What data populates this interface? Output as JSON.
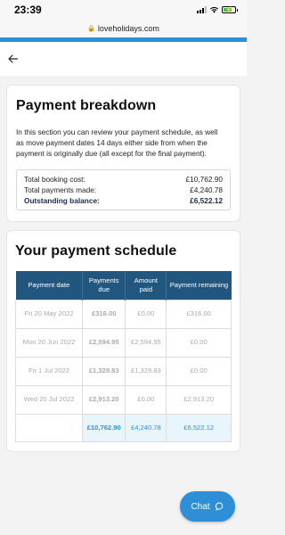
{
  "status_bar": {
    "time": "23:39"
  },
  "browser": {
    "url": "loveholidays.com"
  },
  "breakdown": {
    "title": "Payment breakdown",
    "description": "In this section you can review your payment schedule, as well as move payment dates 14 days either side from when the payment is originally due (all except for the final payment).",
    "rows": [
      {
        "label": "Total booking cost:",
        "value": "£10,762.90"
      },
      {
        "label": "Total payments made:",
        "value": "£4,240.78"
      },
      {
        "label": "Outstanding balance:",
        "value": "£6,522.12"
      }
    ]
  },
  "schedule": {
    "title": "Your payment schedule",
    "headers": [
      "Payment date",
      "Payments due",
      "Amount paid",
      "Payment remaining"
    ],
    "rows": [
      {
        "date": "Fri 20 May 2022",
        "due": "£316.00",
        "paid": "£0.00",
        "remaining": "£316.00"
      },
      {
        "date": "Mon 20 Jun 2022",
        "due": "£2,594.95",
        "paid": "£2,594.95",
        "remaining": "£0.00"
      },
      {
        "date": "Fri 1 Jul 2022",
        "due": "£1,329.83",
        "paid": "£1,329.83",
        "remaining": "£0.00"
      },
      {
        "date": "Wed 20 Jul 2022",
        "due": "£2,913.20",
        "paid": "£0.00",
        "remaining": "£2,913.20"
      }
    ],
    "totals": {
      "due": "£10,762.90",
      "paid": "£4,240.78",
      "remaining": "£6,522.12"
    }
  },
  "chat": {
    "label": "Chat"
  },
  "colors": {
    "brand_blue": "#2e8fd6",
    "header_navy": "#21577f"
  },
  "icons": {
    "back": "arrow-left-icon",
    "chat": "chat-bubble-icon",
    "lock": "lock-icon"
  }
}
